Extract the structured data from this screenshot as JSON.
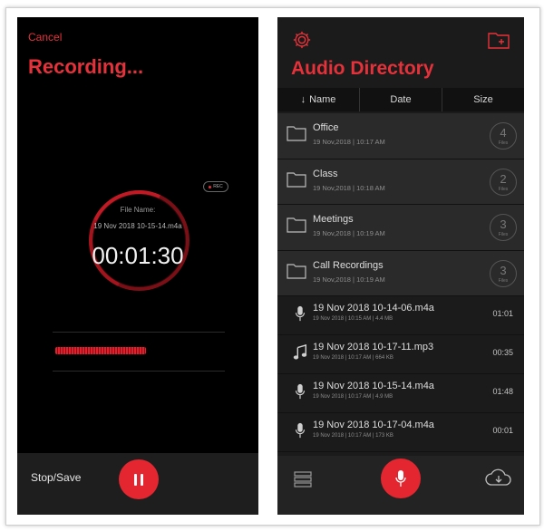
{
  "left": {
    "cancel": "Cancel",
    "title": "Recording...",
    "badge": "REC",
    "file_label": "File Name:",
    "file_value": "19 Nov 2018 10-15-14.m4a",
    "timer": "00:01:30",
    "stop_label": "Stop/Save"
  },
  "right": {
    "title": "Audio Directory",
    "sort": {
      "name": "Name",
      "date": "Date",
      "size": "Size"
    },
    "folders": [
      {
        "name": "Office",
        "date": "19 Nov,2018 | 10:17 AM",
        "count": "4",
        "unit": "Files"
      },
      {
        "name": "Class",
        "date": "19 Nov,2018 | 10:18 AM",
        "count": "2",
        "unit": "Files"
      },
      {
        "name": "Meetings",
        "date": "19 Nov,2018 | 10:19 AM",
        "count": "3",
        "unit": "Files"
      },
      {
        "name": "Call Recordings",
        "date": "19 Nov,2018 | 10:19 AM",
        "count": "3",
        "unit": "Files"
      }
    ],
    "files": [
      {
        "name": "19 Nov 2018 10-14-06.m4a",
        "meta": "19 Nov 2018 | 10:15 AM | 4.4 MB",
        "duration": "01:01",
        "icon": "mic-icon"
      },
      {
        "name": "19 Nov 2018 10-17-11.mp3",
        "meta": "19 Nov 2018 | 10:17 AM | 664 KB",
        "duration": "00:35",
        "icon": "music-note-icon"
      },
      {
        "name": "19 Nov 2018 10-15-14.m4a",
        "meta": "19 Nov 2018 | 10:17 AM | 4.9 MB",
        "duration": "01:48",
        "icon": "mic-icon"
      },
      {
        "name": "19 Nov 2018 10-17-04.m4a",
        "meta": "19 Nov 2018 | 10:17 AM | 173 KB",
        "duration": "00:01",
        "icon": "mic-icon"
      }
    ]
  },
  "colors": {
    "accent": "#e5323a",
    "background": "#000000",
    "folder_row": "#2a2a2a"
  }
}
